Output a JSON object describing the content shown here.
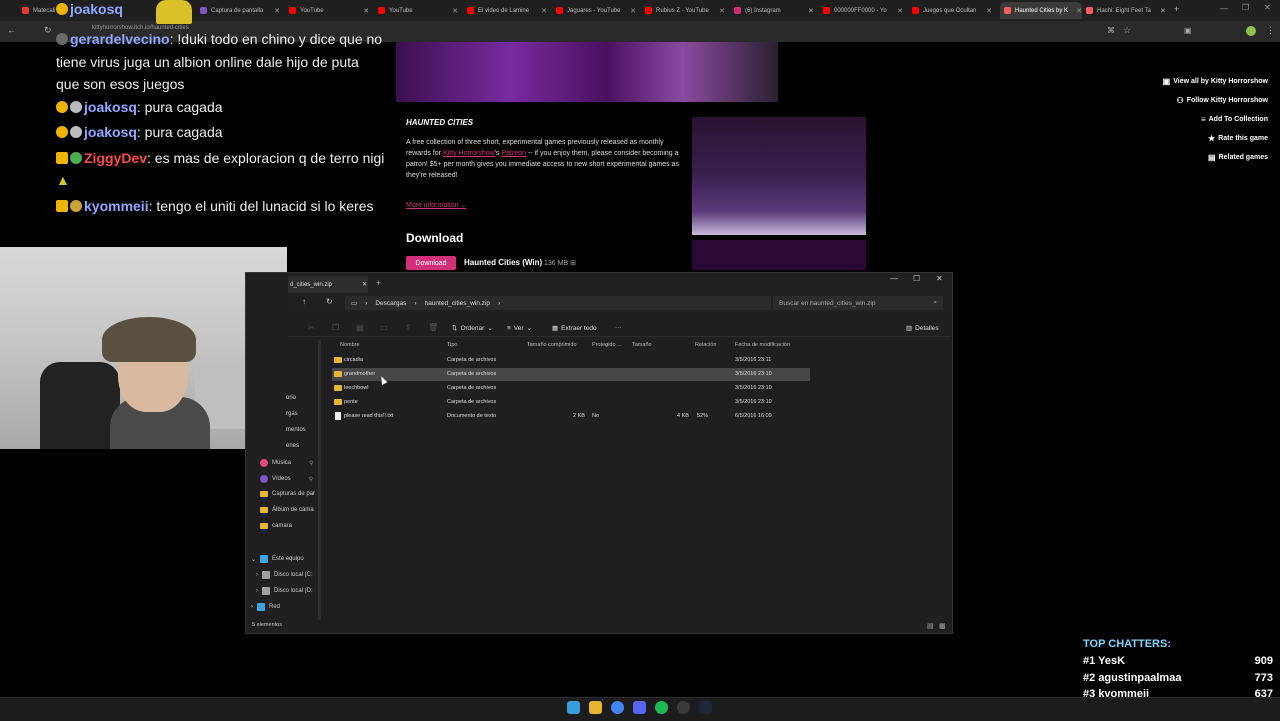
{
  "browser": {
    "tabs": [
      {
        "label": "Matecali",
        "color": "#e53935"
      },
      {
        "label": "Captura de pantalla",
        "color": "#7e57c2"
      },
      {
        "label": "YouTube",
        "color": "#ff0000"
      },
      {
        "label": "YouTube",
        "color": "#ff0000"
      },
      {
        "label": "El video de Lamine",
        "color": "#ff0000"
      },
      {
        "label": "Jaguares - YouTube",
        "color": "#ff0000"
      },
      {
        "label": "Rubius Z - YouTube",
        "color": "#ff0000"
      },
      {
        "label": "(6) Instagram",
        "color": "#d62976"
      },
      {
        "label": "000000FF0000 - Yo",
        "color": "#ff0000"
      },
      {
        "label": "Juegos que Ocultan",
        "color": "#ff0000"
      },
      {
        "label": "Haunted Cities by K",
        "color": "#fa5c5c"
      },
      {
        "label": "Hachi: Eight Feet Ta",
        "color": "#fa5c5c"
      }
    ],
    "url": "kittyhorrorshow.itch.io/haunted-cities"
  },
  "chat": [
    {
      "user": "joakosq",
      "user_color": "blue",
      "text": ""
    },
    {
      "user": "gerardelvecino",
      "user_color": "blue",
      "text": ": !duki todo en chino y dice que no tiene virus juga un albion online dale hijo de puta que son esos juegos"
    },
    {
      "user": "joakosq",
      "user_color": "blue",
      "text": ": pura cagada"
    },
    {
      "user": "joakosq",
      "user_color": "blue",
      "text": ": pura cagada"
    },
    {
      "user": "ZiggyDev",
      "user_color": "red",
      "text": ": es mas de exploracion q de terro nigi"
    },
    {
      "user": "kyommeii",
      "user_color": "blue",
      "text": ": tengo el uniti del lunacid si lo keres"
    }
  ],
  "itch": {
    "title": "HAUNTED CITIES",
    "desc_1": "A free collection of three short, experimental games previously released as monthly rewards for ",
    "desc_link1": "Kitty Horrorshow",
    "desc_2": "'s ",
    "desc_link2": "Patreon",
    "desc_3": " -- if you enjoy them, please consider becoming a patron! $5+ per month gives you immediate access to new short experimental games as they're released!",
    "more_info": "More information",
    "download_heading": "Download",
    "download_button": "Download",
    "file_name": "Haunted Cities (Win)",
    "file_size": "136 MB",
    "side_links": [
      {
        "label": "View all by Kitty Horrorshow",
        "icon": "box-icon"
      },
      {
        "label": "Follow Kitty Horrorshow",
        "icon": "user-plus-icon"
      },
      {
        "label": "Add To Collection",
        "icon": "list-icon"
      },
      {
        "label": "Rate this game",
        "icon": "star-icon"
      },
      {
        "label": "Related games",
        "icon": "book-icon"
      }
    ]
  },
  "explorer": {
    "tab_label": "d_cities_win.zip",
    "breadcrumb": [
      "Descargas",
      "haunted_cities_win.zip"
    ],
    "search_placeholder": "Buscar en haunted_cities_win.zip",
    "toolbar": {
      "sort": "Ordenar",
      "view": "Ver",
      "extract": "Extraer todo",
      "details": "Detalles"
    },
    "columns": {
      "name": "Nombre",
      "type": "Tipo",
      "compressed": "Tamaño comprimido",
      "protected": "Protegido ...",
      "size": "Tamaño",
      "ratio": "Relación",
      "modified": "Fecha de modificación"
    },
    "rows": [
      {
        "name": "circadia",
        "type": "Carpeta de archivos",
        "compressed": "",
        "protected": "",
        "size": "",
        "ratio": "",
        "modified": "3/5/2016 23:11",
        "kind": "folder"
      },
      {
        "name": "grandmother",
        "type": "Carpeta de archivos",
        "compressed": "",
        "protected": "",
        "size": "",
        "ratio": "",
        "modified": "3/5/2016 23:10",
        "kind": "folder"
      },
      {
        "name": "leechbowl",
        "type": "Carpeta de archivos",
        "compressed": "",
        "protected": "",
        "size": "",
        "ratio": "",
        "modified": "3/5/2016 23:10",
        "kind": "folder"
      },
      {
        "name": "pente",
        "type": "Carpeta de archivos",
        "compressed": "",
        "protected": "",
        "size": "",
        "ratio": "",
        "modified": "3/5/2016 23:10",
        "kind": "folder"
      },
      {
        "name": "please read this!!.txt",
        "type": "Documento de texto",
        "compressed": "2 KB",
        "protected": "No",
        "size": "4 KB",
        "ratio": "52%",
        "modified": "6/5/2016 16:09",
        "kind": "text"
      }
    ],
    "nav_items": [
      "orio",
      "rgas",
      "mentos",
      "enes",
      "Música",
      "Vídeos",
      "Capturas de par",
      "Álbum de cáma",
      "camara",
      "Este equipo",
      "Disco local (C:",
      "Disco local (D:",
      "Red"
    ],
    "status": "5 elementos"
  },
  "top_chatters": {
    "title": "TOP CHATTERS:",
    "list": [
      {
        "rank": "#1",
        "name": "YesK",
        "count": "909"
      },
      {
        "rank": "#2",
        "name": "agustinpaalmaa",
        "count": "773"
      },
      {
        "rank": "#3",
        "name": "kyommeii",
        "count": "637"
      }
    ]
  }
}
